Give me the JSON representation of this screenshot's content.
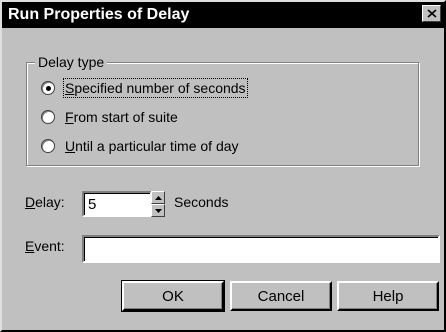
{
  "window": {
    "title": "Run Properties of Delay",
    "close_glyph": "✕"
  },
  "delay_type": {
    "legend": "Delay type",
    "options": [
      {
        "label": "Specified number of seconds",
        "selected": true
      },
      {
        "label": "From start of suite",
        "selected": false
      },
      {
        "label": "Until a particular time of day",
        "selected": false
      }
    ]
  },
  "delay": {
    "label": "Delay:",
    "value": "5",
    "units": "Seconds"
  },
  "event": {
    "label": "Event:",
    "value": ""
  },
  "buttons": {
    "ok": "OK",
    "cancel": "Cancel",
    "help": "Help"
  }
}
